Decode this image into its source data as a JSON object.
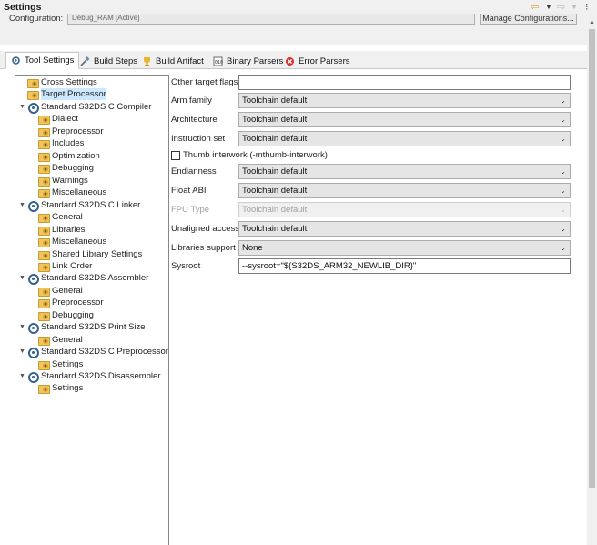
{
  "window": {
    "title": "Settings",
    "nav_back_icon": "back-arrow-icon",
    "nav_forward_icon": "forward-arrow-icon",
    "menu_icon": "vertical-dots-icon"
  },
  "config": {
    "label": "Configuration:",
    "value": "Debug_RAM [Active]",
    "manage_button": "Manage Configurations..."
  },
  "tabs": [
    {
      "label": "Tool Settings",
      "icon": "tool-settings-icon",
      "active": true
    },
    {
      "label": "Build Steps",
      "icon": "build-steps-icon"
    },
    {
      "label": "Build Artifact",
      "icon": "build-artifact-icon"
    },
    {
      "label": "Binary Parsers",
      "icon": "binary-parsers-icon"
    },
    {
      "label": "Error Parsers",
      "icon": "error-parsers-icon"
    }
  ],
  "tree": [
    {
      "label": "Cross Settings",
      "level": 1,
      "icon": "folder"
    },
    {
      "label": "Target Processor",
      "level": 1,
      "icon": "folder",
      "selected": true
    },
    {
      "label": "Standard S32DS C Compiler",
      "level": 0,
      "icon": "tool",
      "expanded": true
    },
    {
      "label": "Dialect",
      "level": 2,
      "icon": "folder"
    },
    {
      "label": "Preprocessor",
      "level": 2,
      "icon": "folder"
    },
    {
      "label": "Includes",
      "level": 2,
      "icon": "folder"
    },
    {
      "label": "Optimization",
      "level": 2,
      "icon": "folder"
    },
    {
      "label": "Debugging",
      "level": 2,
      "icon": "folder"
    },
    {
      "label": "Warnings",
      "level": 2,
      "icon": "folder"
    },
    {
      "label": "Miscellaneous",
      "level": 2,
      "icon": "folder"
    },
    {
      "label": "Standard S32DS C Linker",
      "level": 0,
      "icon": "tool",
      "expanded": true
    },
    {
      "label": "General",
      "level": 2,
      "icon": "folder"
    },
    {
      "label": "Libraries",
      "level": 2,
      "icon": "folder"
    },
    {
      "label": "Miscellaneous",
      "level": 2,
      "icon": "folder"
    },
    {
      "label": "Shared Library Settings",
      "level": 2,
      "icon": "folder"
    },
    {
      "label": "Link Order",
      "level": 2,
      "icon": "folder"
    },
    {
      "label": "Standard S32DS Assembler",
      "level": 0,
      "icon": "tool",
      "expanded": true
    },
    {
      "label": "General",
      "level": 2,
      "icon": "folder"
    },
    {
      "label": "Preprocessor",
      "level": 2,
      "icon": "folder"
    },
    {
      "label": "Debugging",
      "level": 2,
      "icon": "folder"
    },
    {
      "label": "Standard S32DS Print Size",
      "level": 0,
      "icon": "tool",
      "expanded": true
    },
    {
      "label": "General",
      "level": 2,
      "icon": "folder"
    },
    {
      "label": "Standard S32DS C Preprocessor",
      "level": 0,
      "icon": "tool",
      "expanded": true
    },
    {
      "label": "Settings",
      "level": 2,
      "icon": "folder"
    },
    {
      "label": "Standard S32DS Disassembler",
      "level": 0,
      "icon": "tool",
      "expanded": true
    },
    {
      "label": "Settings",
      "level": 2,
      "icon": "folder"
    }
  ],
  "form": {
    "other_flags": {
      "label": "Other target flags",
      "value": ""
    },
    "arm_family": {
      "label": "Arm family",
      "value": "Toolchain default"
    },
    "architecture": {
      "label": "Architecture",
      "value": "Toolchain default"
    },
    "instruction_set": {
      "label": "Instruction set",
      "value": "Toolchain default"
    },
    "thumb_interwork": {
      "label": "Thumb interwork (-mthumb-interwork)",
      "checked": false
    },
    "endianness": {
      "label": "Endianness",
      "value": "Toolchain default"
    },
    "float_abi": {
      "label": "Float ABI",
      "value": "Toolchain default"
    },
    "fpu_type": {
      "label": "FPU Type",
      "value": "Toolchain default",
      "disabled": true
    },
    "unaligned_access": {
      "label": "Unaligned access",
      "value": "Toolchain default"
    },
    "libraries_support": {
      "label": "Libraries support",
      "value": "None"
    },
    "sysroot": {
      "label": "Sysroot",
      "value": "--sysroot=\"${S32DS_ARM32_NEWLIB_DIR}\""
    }
  }
}
